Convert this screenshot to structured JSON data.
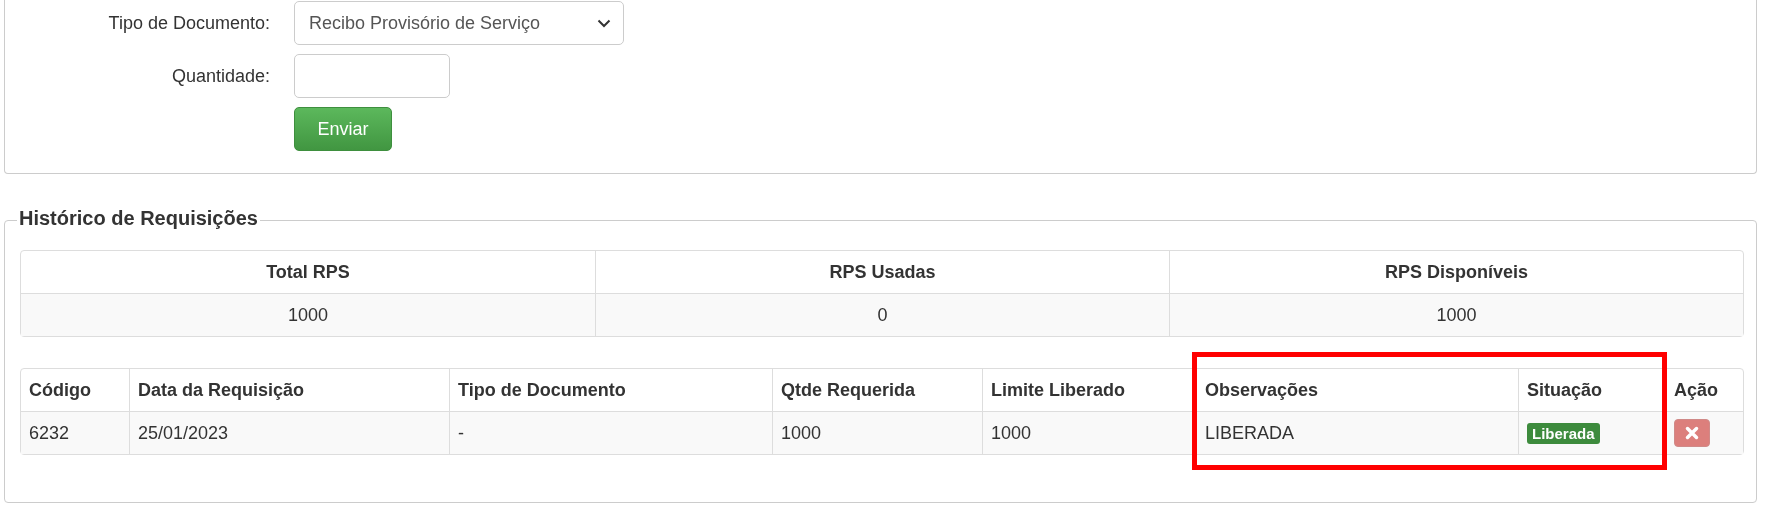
{
  "request_form": {
    "fields": [
      {
        "kind": "select",
        "label": "Tipo de Documento:",
        "value": "Recibo Provisório de Serviço"
      },
      {
        "kind": "input",
        "label": "Quantidade:"
      }
    ],
    "submit": "Enviar"
  },
  "history": {
    "legend": "Histórico de Requisições",
    "summary": {
      "columns": [
        "Total RPS",
        "RPS Usadas",
        "RPS Disponíveis"
      ],
      "values": [
        "1000",
        "0",
        "1000"
      ]
    },
    "table": {
      "columns": [
        {
          "label": "Código",
          "highlighted": false
        },
        {
          "label": "Data da Requisição",
          "highlighted": false
        },
        {
          "label": "Tipo de Documento",
          "highlighted": false
        },
        {
          "label": "Qtde Requerida",
          "highlighted": false
        },
        {
          "label": "Limite Liberado",
          "highlighted": false
        },
        {
          "label": "Observações",
          "highlighted": true
        },
        {
          "label": "Situação",
          "highlighted": true
        },
        {
          "label": "Ação",
          "highlighted": false
        }
      ],
      "rows": [
        {
          "cells": [
            "6232",
            "25/01/2023",
            "-",
            "1000",
            "1000",
            "LIBERADA"
          ],
          "status": "Liberada"
        }
      ]
    }
  }
}
